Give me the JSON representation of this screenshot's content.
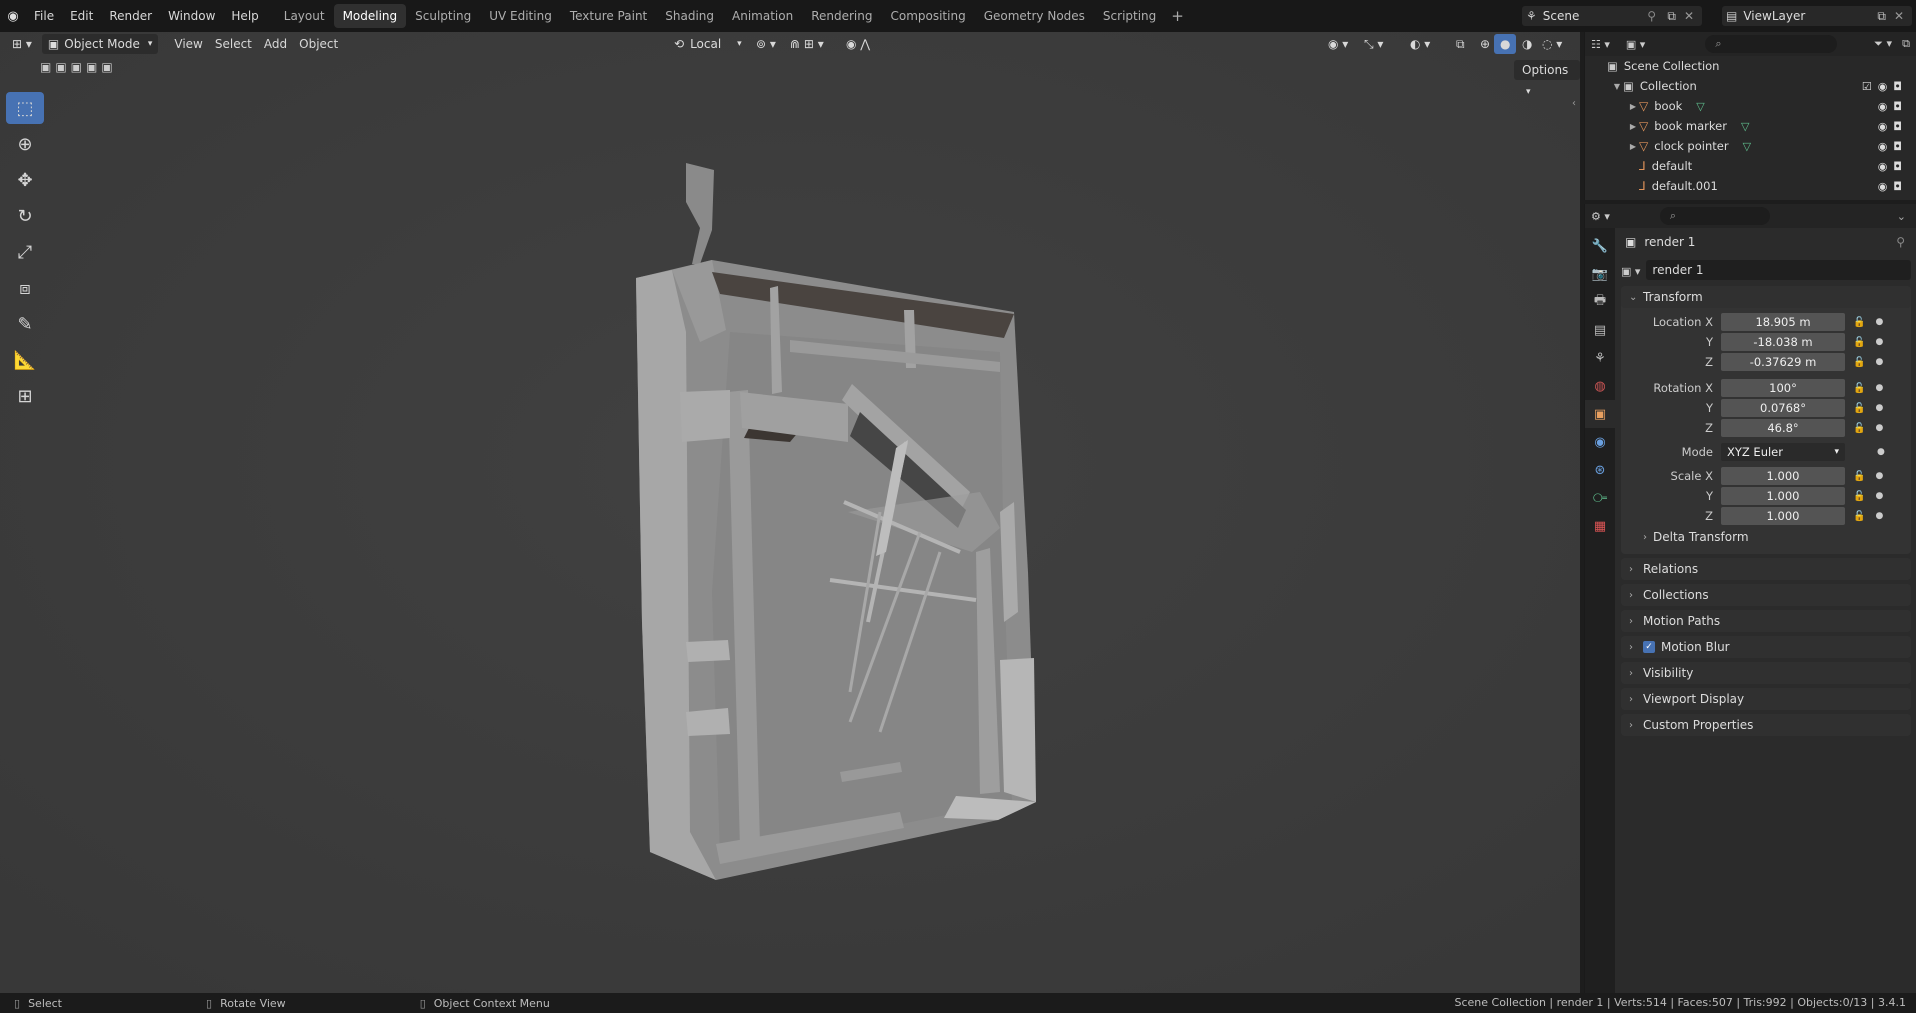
{
  "menu": {
    "items": [
      "File",
      "Edit",
      "Render",
      "Window",
      "Help"
    ]
  },
  "workspaces": {
    "tabs": [
      "Layout",
      "Modeling",
      "Sculpting",
      "UV Editing",
      "Texture Paint",
      "Shading",
      "Animation",
      "Rendering",
      "Compositing",
      "Geometry Nodes",
      "Scripting"
    ],
    "active": "Modeling"
  },
  "scene": {
    "name": "Scene",
    "view_layer": "ViewLayer"
  },
  "viewport_header": {
    "mode": "Object Mode",
    "menus": [
      "View",
      "Select",
      "Add",
      "Object"
    ],
    "orientation": "Local",
    "options_label": "Options"
  },
  "outliner": {
    "root": "Scene Collection",
    "collection": "Collection",
    "items": [
      {
        "name": "book",
        "has_mesh": true
      },
      {
        "name": "book marker",
        "has_mesh": true
      },
      {
        "name": "clock pointer",
        "has_mesh": true
      },
      {
        "name": "default",
        "has_mesh": false
      },
      {
        "name": "default.001",
        "has_mesh": false
      }
    ]
  },
  "properties": {
    "object_name": "render 1",
    "data_name": "render 1",
    "transform": {
      "title": "Transform",
      "location": {
        "label": "Location X",
        "x": "18.905 m",
        "y": "-18.038 m",
        "z": "-0.37629 m"
      },
      "rotation": {
        "label": "Rotation X",
        "x": "100°",
        "y": "0.0768°",
        "z": "46.8°"
      },
      "mode_label": "Mode",
      "mode_value": "XYZ Euler",
      "scale": {
        "label": "Scale X",
        "x": "1.000",
        "y": "1.000",
        "z": "1.000"
      },
      "axis_y": "Y",
      "axis_z": "Z",
      "delta": "Delta Transform"
    },
    "panels": [
      "Relations",
      "Collections",
      "Motion Paths",
      "Motion Blur",
      "Visibility",
      "Viewport Display",
      "Custom Properties"
    ]
  },
  "statusbar": {
    "select": "Select",
    "rotate": "Rotate View",
    "context": "Object Context Menu",
    "stats": "Scene Collection | render 1 | Verts:514 | Faces:507 | Tris:992 | Objects:0/13 | 3.4.1"
  }
}
